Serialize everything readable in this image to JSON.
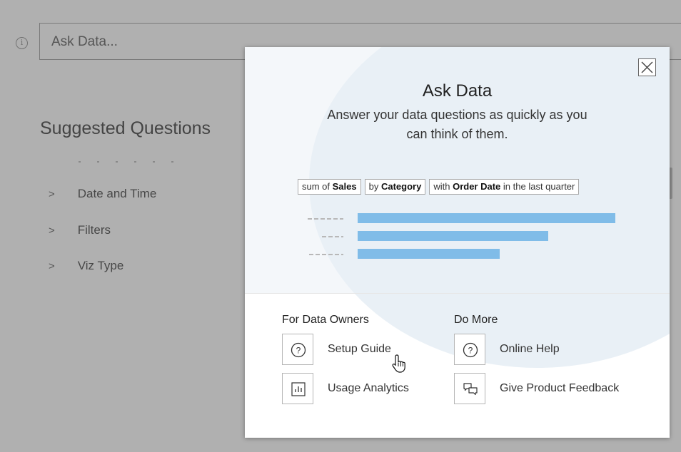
{
  "background": {
    "search_placeholder": "Ask Data...",
    "suggested_title": "Suggested Questions",
    "suggested_items": [
      {
        "label": "Date and Time"
      },
      {
        "label": "Filters"
      },
      {
        "label": "Viz Type"
      }
    ]
  },
  "modal": {
    "title": "Ask Data",
    "subtitle": "Answer your data questions as quickly as you can think of them.",
    "pills": [
      {
        "prefix": "sum of",
        "bold": "Sales",
        "suffix": ""
      },
      {
        "prefix": "by",
        "bold": "Category",
        "suffix": ""
      },
      {
        "prefix": "with",
        "bold": "Order Date",
        "suffix": "in the last quarter"
      }
    ],
    "chart_data": {
      "type": "bar",
      "orientation": "horizontal",
      "values": [
        1.0,
        0.74,
        0.55
      ]
    },
    "for_data_owners": {
      "title": "For Data Owners",
      "links": [
        {
          "label": "Setup Guide",
          "icon": "question-circle-icon"
        },
        {
          "label": "Usage Analytics",
          "icon": "bar-chart-icon"
        }
      ]
    },
    "do_more": {
      "title": "Do More",
      "links": [
        {
          "label": "Online Help",
          "icon": "question-circle-icon"
        },
        {
          "label": "Give Product Feedback",
          "icon": "speech-bubbles-icon"
        }
      ]
    }
  },
  "colors": {
    "bar": "#80bce8",
    "overlay": "rgba(88,88,88,0.47)"
  }
}
